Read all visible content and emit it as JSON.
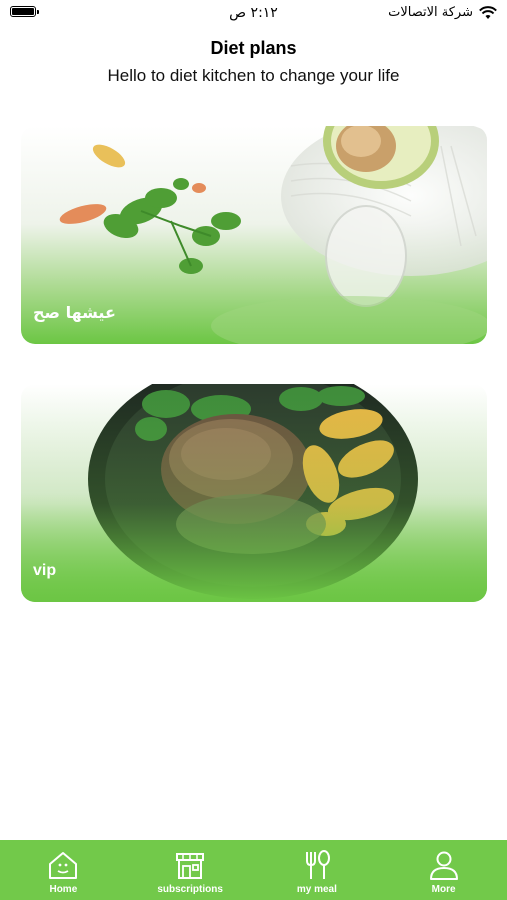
{
  "status": {
    "time": "٢:١٢ ص",
    "carrier": "شركة الاتصالات"
  },
  "header": {
    "title": "Diet plans",
    "subtitle": "Hello to diet kitchen to change your life"
  },
  "plans": [
    {
      "label": "عيشها صح"
    },
    {
      "label": "vip"
    }
  ],
  "tabs": [
    {
      "label": "Home",
      "icon": "home-icon"
    },
    {
      "label": "subscriptions",
      "icon": "store-icon"
    },
    {
      "label": "my meal",
      "icon": "fork-spoon-icon"
    },
    {
      "label": "More",
      "icon": "user-icon"
    }
  ],
  "colors": {
    "accent": "#72c94a",
    "card_gradient_bottom": "#6cc644"
  }
}
